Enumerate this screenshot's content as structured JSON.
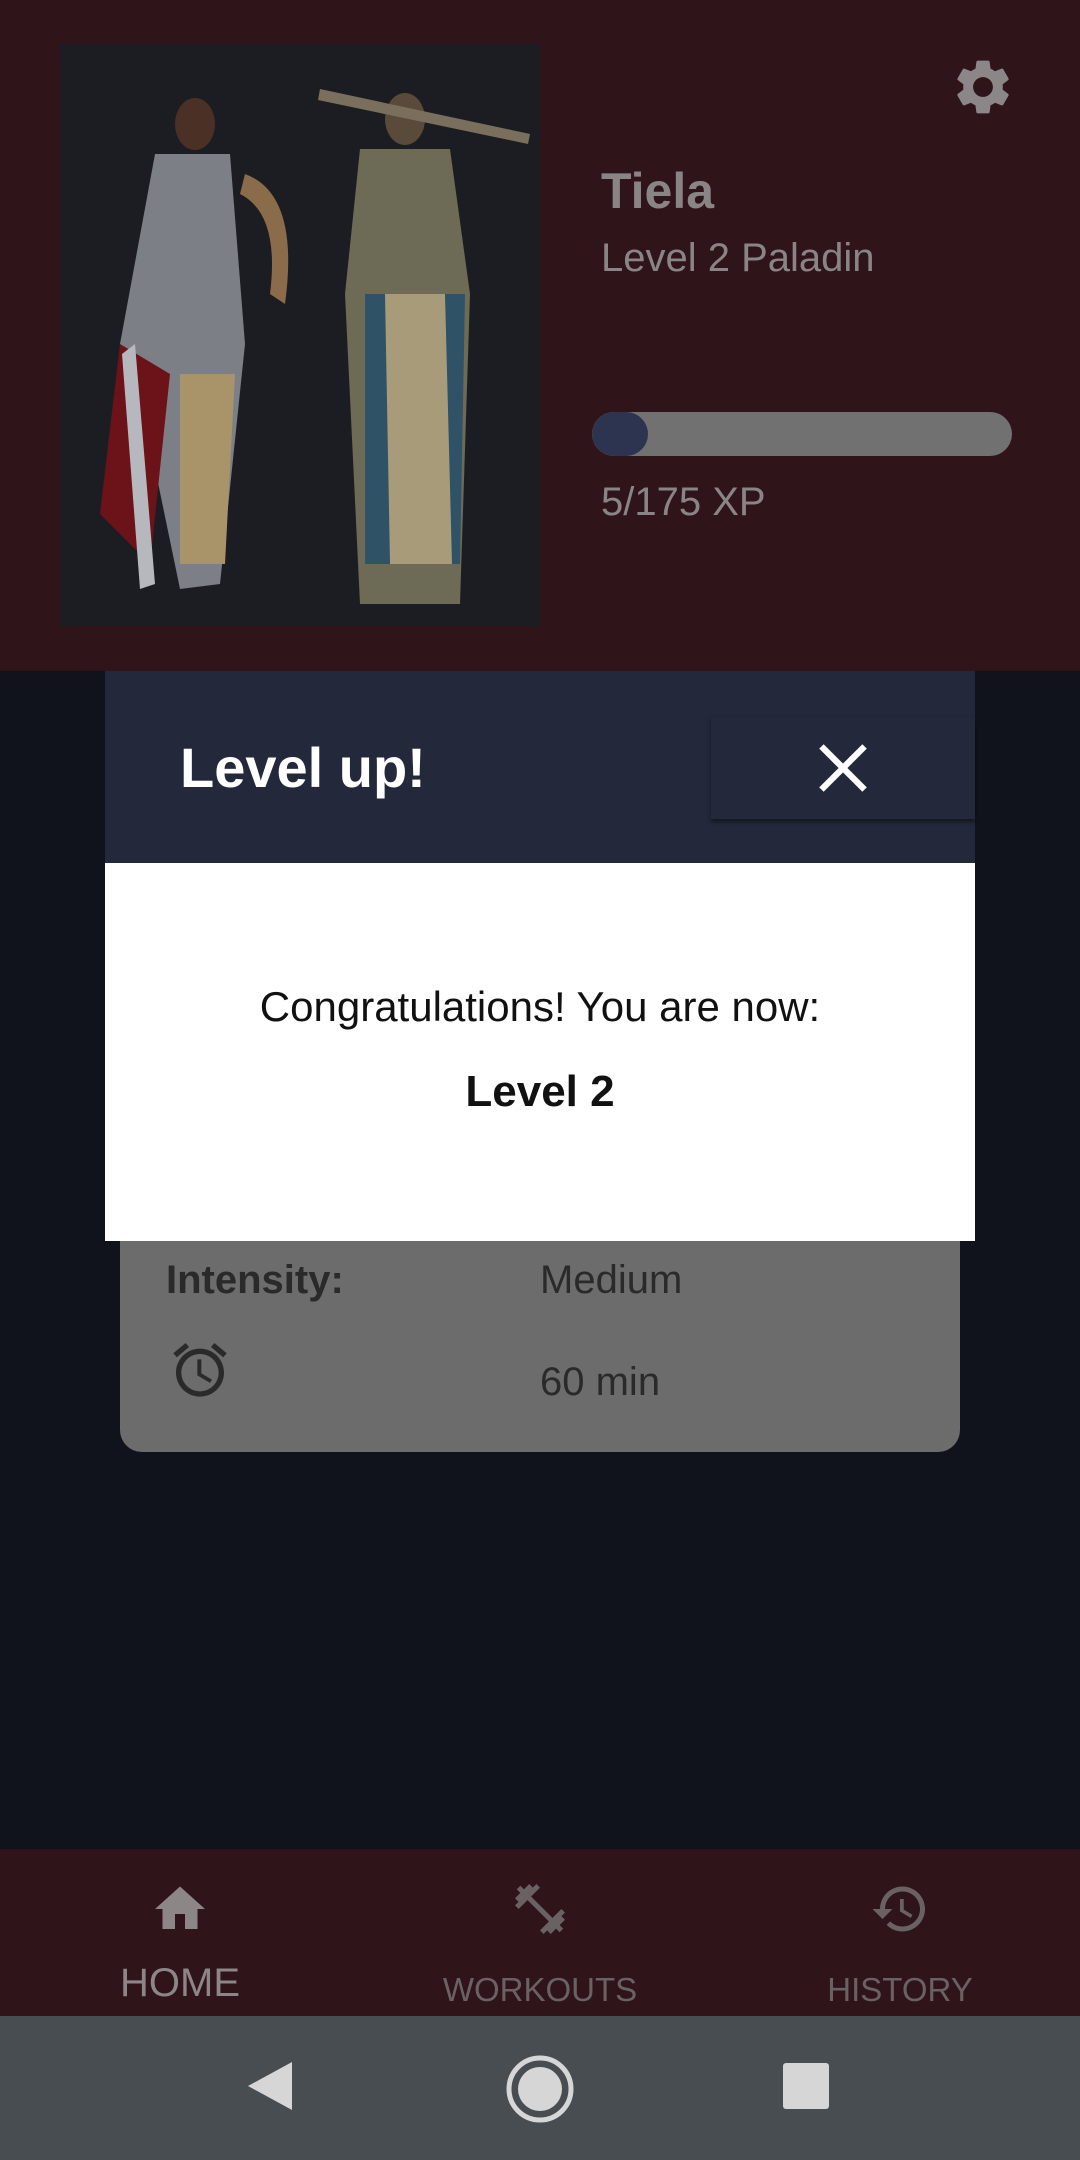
{
  "character": {
    "name": "Tiela",
    "class_line": "Level 2 Paladin",
    "xp_text": "5/175 XP",
    "xp_current": 5,
    "xp_max": 175
  },
  "header": {
    "settings_icon": "gear-icon",
    "portrait": "character-portrait"
  },
  "workout_card": {
    "intensity_label": "Intensity:",
    "intensity_value": "Medium",
    "duration_icon": "alarm-clock-icon",
    "duration_value": "60 min"
  },
  "modal": {
    "title": "Level up!",
    "close_icon": "close-icon",
    "message": "Congratulations! You are now:",
    "level_text": "Level 2"
  },
  "tabs": [
    {
      "label": "HOME",
      "icon": "home-icon",
      "active": true
    },
    {
      "label": "WORKOUTS",
      "icon": "dumbbell-icon",
      "active": false
    },
    {
      "label": "HISTORY",
      "icon": "history-icon",
      "active": false
    }
  ],
  "system_nav": {
    "back_icon": "back-triangle-icon",
    "home_icon": "home-circle-icon",
    "recents_icon": "recents-square-icon"
  },
  "colors": {
    "header_bg": "#2f1419",
    "page_bg": "#11131c",
    "modal_header_bg": "#23283a",
    "xp_fill": "#2c3450"
  }
}
